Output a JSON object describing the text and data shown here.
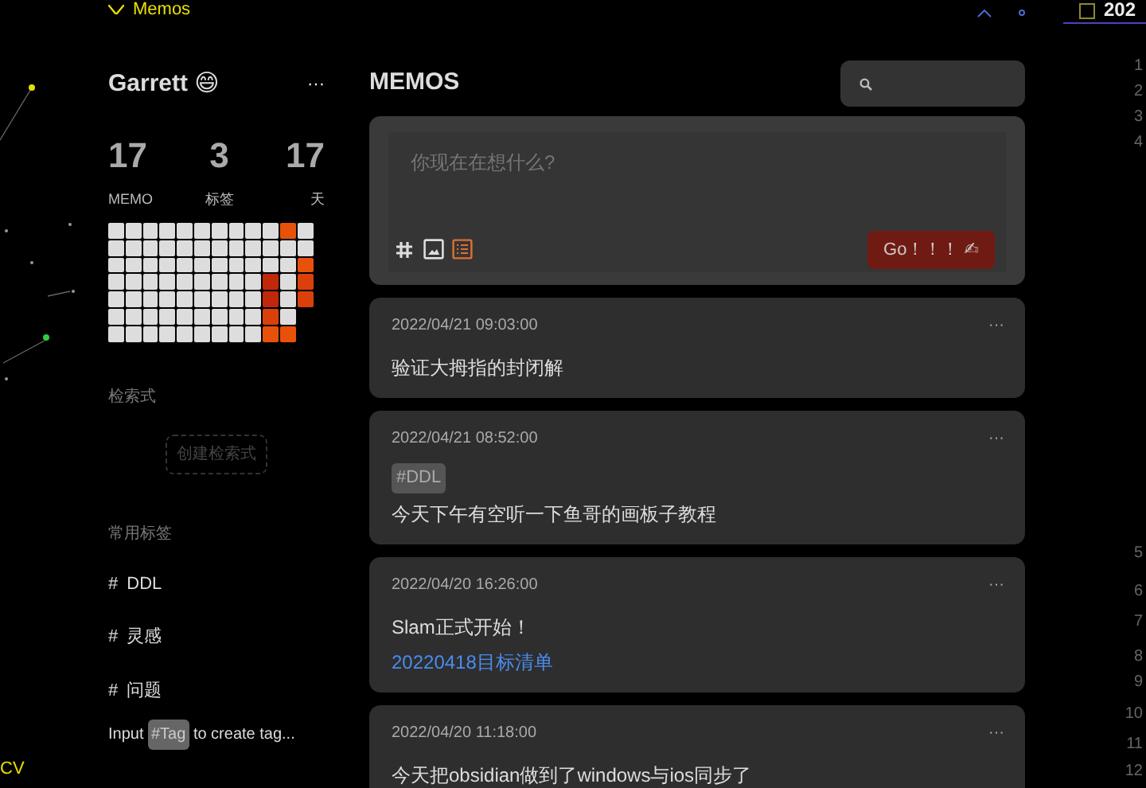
{
  "top_bar": {
    "title": "Memos",
    "right_pane_title": "202"
  },
  "graph_label": "CV",
  "sidebar": {
    "user": "Garrett 😄",
    "more": "···",
    "stats": [
      {
        "value": "17",
        "label": "MEMO"
      },
      {
        "value": "3",
        "label": "标签"
      },
      {
        "value": "17",
        "label": "天"
      }
    ],
    "heatmap": [
      {
        "cells": [
          {
            "color": "#dddddd"
          },
          {
            "color": "#dddddd"
          },
          {
            "color": "#dddddd"
          },
          {
            "color": "#dddddd"
          },
          {
            "color": "#dddddd"
          },
          {
            "color": "#dddddd"
          },
          {
            "color": "#dddddd"
          },
          {
            "color": "#dddddd"
          },
          {
            "color": "#dddddd"
          },
          {
            "color": "#dddddd"
          },
          {
            "color": "#e8510a"
          },
          {
            "color": "#dddddd"
          }
        ]
      },
      {
        "cells": [
          {
            "color": "#dddddd"
          },
          {
            "color": "#dddddd"
          },
          {
            "color": "#dddddd"
          },
          {
            "color": "#dddddd"
          },
          {
            "color": "#dddddd"
          },
          {
            "color": "#dddddd"
          },
          {
            "color": "#dddddd"
          },
          {
            "color": "#dddddd"
          },
          {
            "color": "#dddddd"
          },
          {
            "color": "#dddddd"
          },
          {
            "color": "#dddddd"
          },
          {
            "color": "#dddddd"
          }
        ]
      },
      {
        "cells": [
          {
            "color": "#dddddd"
          },
          {
            "color": "#dddddd"
          },
          {
            "color": "#dddddd"
          },
          {
            "color": "#dddddd"
          },
          {
            "color": "#dddddd"
          },
          {
            "color": "#dddddd"
          },
          {
            "color": "#dddddd"
          },
          {
            "color": "#dddddd"
          },
          {
            "color": "#dddddd"
          },
          {
            "color": "#dddddd"
          },
          {
            "color": "#dddddd"
          },
          {
            "color": "#e8510a"
          }
        ]
      },
      {
        "cells": [
          {
            "color": "#dddddd"
          },
          {
            "color": "#dddddd"
          },
          {
            "color": "#dddddd"
          },
          {
            "color": "#dddddd"
          },
          {
            "color": "#dddddd"
          },
          {
            "color": "#dddddd"
          },
          {
            "color": "#dddddd"
          },
          {
            "color": "#dddddd"
          },
          {
            "color": "#dddddd"
          },
          {
            "color": "#c0280a"
          },
          {
            "color": "#dddddd"
          },
          {
            "color": "#d9400a"
          }
        ]
      },
      {
        "cells": [
          {
            "color": "#dddddd"
          },
          {
            "color": "#dddddd"
          },
          {
            "color": "#dddddd"
          },
          {
            "color": "#dddddd"
          },
          {
            "color": "#dddddd"
          },
          {
            "color": "#dddddd"
          },
          {
            "color": "#dddddd"
          },
          {
            "color": "#dddddd"
          },
          {
            "color": "#dddddd"
          },
          {
            "color": "#c0280a"
          },
          {
            "color": "#dddddd"
          },
          {
            "color": "#d9400a"
          }
        ]
      },
      {
        "cells": [
          {
            "color": "#dddddd"
          },
          {
            "color": "#dddddd"
          },
          {
            "color": "#dddddd"
          },
          {
            "color": "#dddddd"
          },
          {
            "color": "#dddddd"
          },
          {
            "color": "#dddddd"
          },
          {
            "color": "#dddddd"
          },
          {
            "color": "#dddddd"
          },
          {
            "color": "#dddddd"
          },
          {
            "color": "#d9400a"
          },
          {
            "color": "#dddddd"
          }
        ]
      },
      {
        "cells": [
          {
            "color": "#dddddd"
          },
          {
            "color": "#dddddd"
          },
          {
            "color": "#dddddd"
          },
          {
            "color": "#dddddd"
          },
          {
            "color": "#dddddd"
          },
          {
            "color": "#dddddd"
          },
          {
            "color": "#dddddd"
          },
          {
            "color": "#dddddd"
          },
          {
            "color": "#dddddd"
          },
          {
            "color": "#e8510a"
          },
          {
            "color": "#e8510a"
          }
        ]
      }
    ],
    "queries_heading": "检索式",
    "create_query_button": "创建检索式",
    "tags_heading": "常用标签",
    "tags": [
      {
        "hash": "#",
        "name": "DDL"
      },
      {
        "hash": "#",
        "name": "灵感"
      },
      {
        "hash": "#",
        "name": "问题"
      }
    ],
    "hint": {
      "before": "Input",
      "tag": "#Tag",
      "after": "to create tag..."
    }
  },
  "main": {
    "title": "MEMOS",
    "editor": {
      "placeholder": "你现在在想什么?",
      "submit": "Go！！！ ✍"
    },
    "memos": [
      {
        "time": "2022/04/21 09:03:00",
        "more": "···",
        "text": "验证大拇指的封闭解"
      },
      {
        "time": "2022/04/21 08:52:00",
        "more": "···",
        "tag": "#DDL",
        "text": "今天下午有空听一下鱼哥的画板子教程"
      },
      {
        "time": "2022/04/20 16:26:00",
        "more": "···",
        "text": "Slam正式开始！",
        "link": "20220418目标清单"
      },
      {
        "time": "2022/04/20 11:18:00",
        "more": "···",
        "text": "今天把obsidian做到了windows与ios同步了"
      }
    ]
  },
  "line_numbers": [
    "1",
    "2",
    "3",
    "4",
    "5",
    "6",
    "7",
    "8",
    "9",
    "10",
    "11",
    "12"
  ]
}
